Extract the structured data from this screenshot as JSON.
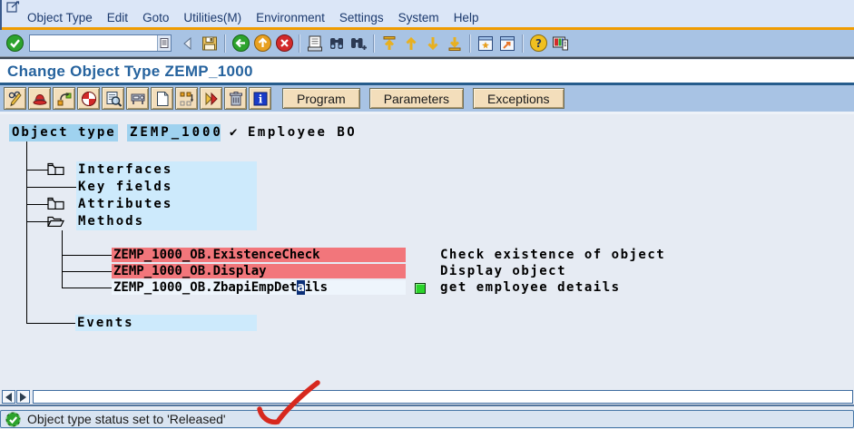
{
  "colors": {
    "accent_orange": "#f09c00",
    "toolbar_blue": "#a8c3e4",
    "menu_bg": "#dbe6f7",
    "content_bg": "#e6ebf3",
    "tree_highlight": "#cdeafc",
    "header_highlight": "#9fd2ef",
    "method_error_red": "#f2767b",
    "method_selected_bg": "#eef5fc",
    "released_green": "#2ad42a",
    "title_blue": "#26639e",
    "annotation_red": "#d7281e"
  },
  "menu_bar": {
    "items": [
      "Object Type",
      "Edit",
      "Goto",
      "Utilities(M)",
      "Environment",
      "Settings",
      "System",
      "Help"
    ]
  },
  "system_toolbar": {
    "command_field": {
      "value": "",
      "placeholder": ""
    },
    "icons": [
      "enter-icon",
      "command-dropdown-icon",
      "collapse-icon",
      "save-icon",
      "back-icon",
      "exit-icon",
      "cancel-icon",
      "print-icon",
      "find-icon",
      "find-next-icon",
      "first-page-icon",
      "page-up-icon",
      "page-down-icon",
      "last-page-icon",
      "new-session-icon",
      "create-shortcut-icon",
      "help-icon",
      "customize-layout-icon"
    ]
  },
  "title_bar": {
    "title": "Change Object Type ZEMP_1000"
  },
  "app_toolbar": {
    "icons": [
      "display-change-icon",
      "test-icon",
      "where-used-icon",
      "generate-icon",
      "display-program-icon",
      "utilities-icon",
      "create-icon",
      "change-position-icon",
      "execute-icon",
      "delete-icon",
      "documentation-icon"
    ],
    "buttons": [
      {
        "label": "Program"
      },
      {
        "label": "Parameters"
      },
      {
        "label": "Exceptions"
      }
    ]
  },
  "object_header": {
    "label": "Object type",
    "value": "ZEMP_1000",
    "check": "✔",
    "description": "Employee BO"
  },
  "tree": {
    "nodes": [
      {
        "label": "Interfaces",
        "icon": "closed-folder"
      },
      {
        "label": "Key fields",
        "icon": "none"
      },
      {
        "label": "Attributes",
        "icon": "closed-folder"
      },
      {
        "label": "Methods",
        "icon": "open-folder"
      },
      {
        "label": "Events",
        "icon": "none"
      }
    ],
    "methods": [
      {
        "name": "ZEMP_1000_OB.ExistenceCheck",
        "description": "Check existence of object",
        "state": "error"
      },
      {
        "name": "ZEMP_1000_OB.Display",
        "description": "Display object",
        "state": "error"
      },
      {
        "name_pre": "ZEMP_1000_OB.ZbapiEmpDet",
        "cursor_char": "a",
        "name_post": "ils",
        "description": "get employee details",
        "state": "released",
        "status_icon": "green-square"
      }
    ]
  },
  "status_bar": {
    "icon": "success-check-icon",
    "message": "Object type status set to 'Released'"
  },
  "annotation": {
    "shape": "hand-drawn-red-checkmark"
  }
}
